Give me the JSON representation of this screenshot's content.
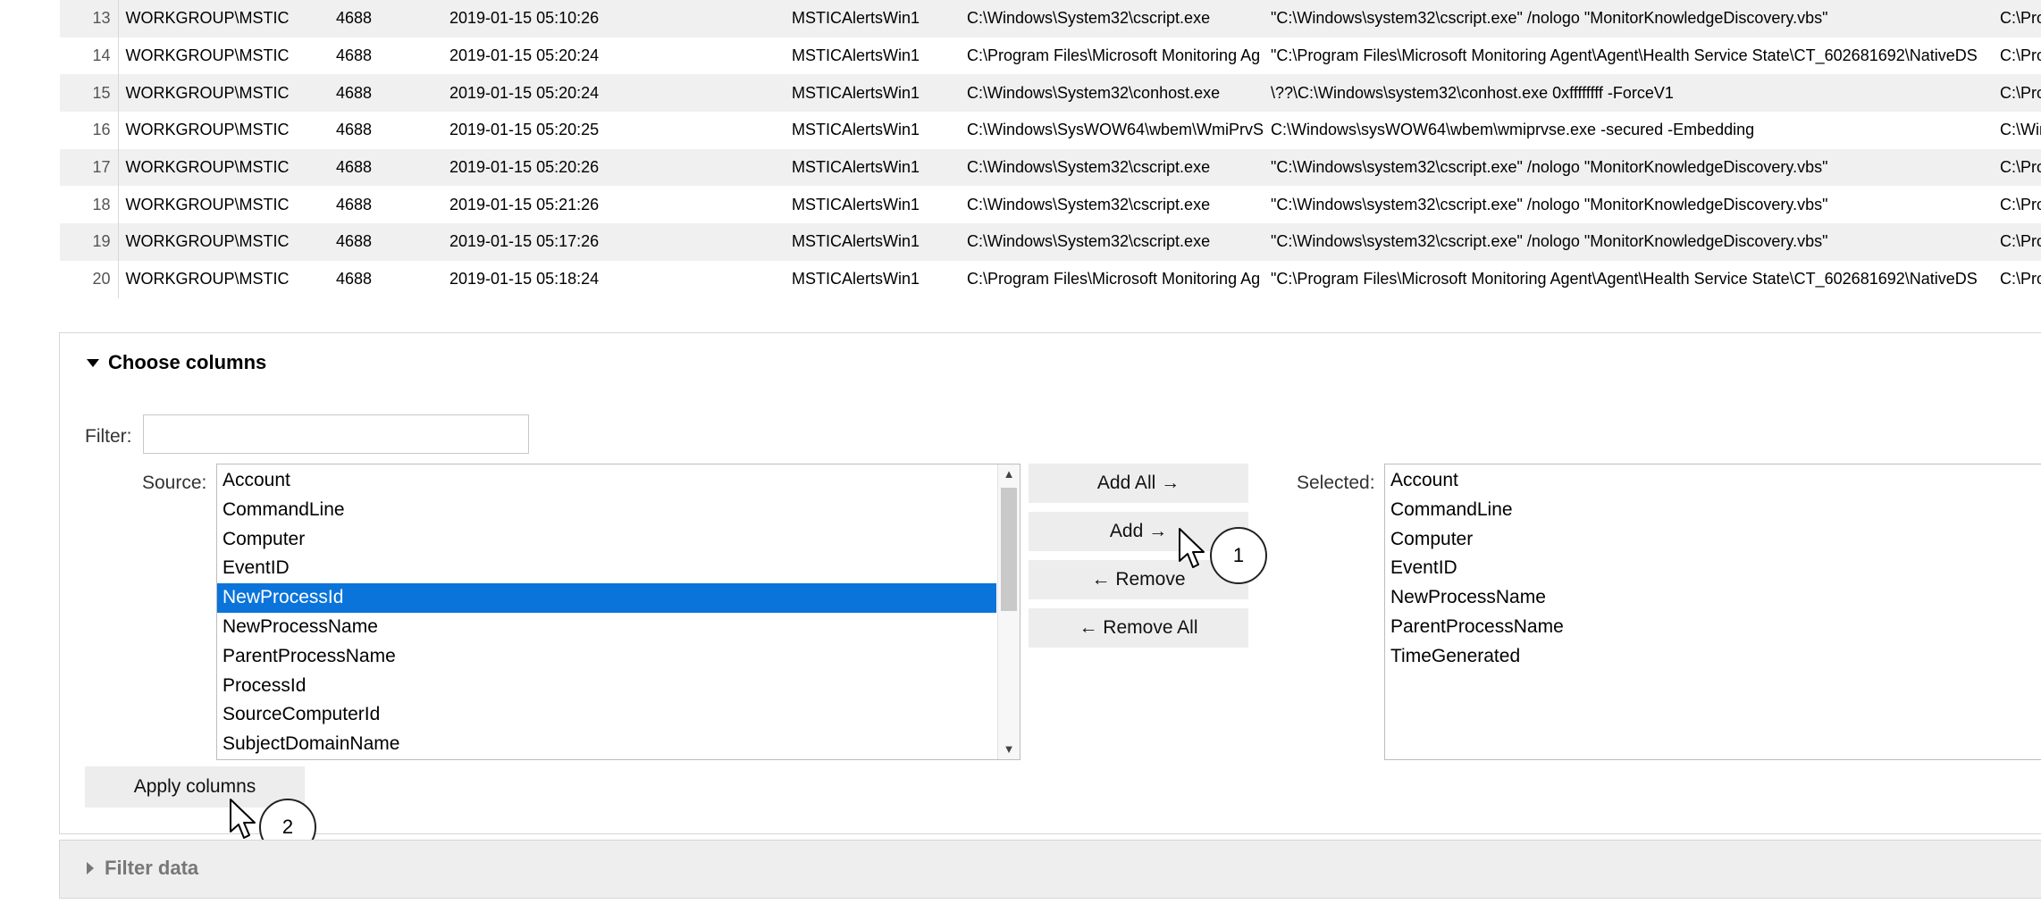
{
  "table": {
    "rows": [
      {
        "idx": "13",
        "account": "WORKGROUP\\MSTIC",
        "event_id": "4688",
        "time": "2019-01-15 05:10:26",
        "computer": "MSTICAlertsWin1",
        "process": "C:\\Windows\\System32\\cscript.exe",
        "cmdline": "\"C:\\Windows\\system32\\cscript.exe\" /nologo \"MonitorKnowledgeDiscovery.vbs\"",
        "parent": "C:\\Progra"
      },
      {
        "idx": "14",
        "account": "WORKGROUP\\MSTIC",
        "event_id": "4688",
        "time": "2019-01-15 05:20:24",
        "computer": "MSTICAlertsWin1",
        "process": "C:\\Program Files\\Microsoft Monitoring Ag",
        "cmdline": "\"C:\\Program Files\\Microsoft Monitoring Agent\\Agent\\Health Service State\\CT_602681692\\NativeDS",
        "parent": "C:\\Progra"
      },
      {
        "idx": "15",
        "account": "WORKGROUP\\MSTIC",
        "event_id": "4688",
        "time": "2019-01-15 05:20:24",
        "computer": "MSTICAlertsWin1",
        "process": "C:\\Windows\\System32\\conhost.exe",
        "cmdline": "\\??\\C:\\Windows\\system32\\conhost.exe 0xffffffff -ForceV1",
        "parent": "C:\\Progra"
      },
      {
        "idx": "16",
        "account": "WORKGROUP\\MSTIC",
        "event_id": "4688",
        "time": "2019-01-15 05:20:25",
        "computer": "MSTICAlertsWin1",
        "process": "C:\\Windows\\SysWOW64\\wbem\\WmiPrvS",
        "cmdline": "C:\\Windows\\sysWOW64\\wbem\\wmiprvse.exe -secured -Embedding",
        "parent": "C:\\Windo"
      },
      {
        "idx": "17",
        "account": "WORKGROUP\\MSTIC",
        "event_id": "4688",
        "time": "2019-01-15 05:20:26",
        "computer": "MSTICAlertsWin1",
        "process": "C:\\Windows\\System32\\cscript.exe",
        "cmdline": "\"C:\\Windows\\system32\\cscript.exe\" /nologo \"MonitorKnowledgeDiscovery.vbs\"",
        "parent": "C:\\Progra"
      },
      {
        "idx": "18",
        "account": "WORKGROUP\\MSTIC",
        "event_id": "4688",
        "time": "2019-01-15 05:21:26",
        "computer": "MSTICAlertsWin1",
        "process": "C:\\Windows\\System32\\cscript.exe",
        "cmdline": "\"C:\\Windows\\system32\\cscript.exe\" /nologo \"MonitorKnowledgeDiscovery.vbs\"",
        "parent": "C:\\Progra"
      },
      {
        "idx": "19",
        "account": "WORKGROUP\\MSTIC",
        "event_id": "4688",
        "time": "2019-01-15 05:17:26",
        "computer": "MSTICAlertsWin1",
        "process": "C:\\Windows\\System32\\cscript.exe",
        "cmdline": "\"C:\\Windows\\system32\\cscript.exe\" /nologo \"MonitorKnowledgeDiscovery.vbs\"",
        "parent": "C:\\Progra"
      },
      {
        "idx": "20",
        "account": "WORKGROUP\\MSTIC",
        "event_id": "4688",
        "time": "2019-01-15 05:18:24",
        "computer": "MSTICAlertsWin1",
        "process": "C:\\Program Files\\Microsoft Monitoring Ag",
        "cmdline": "\"C:\\Program Files\\Microsoft Monitoring Agent\\Agent\\Health Service State\\CT_602681692\\NativeDS",
        "parent": "C:\\Progra"
      }
    ]
  },
  "choose_columns": {
    "title": "Choose columns",
    "filter_label": "Filter:",
    "filter_value": "",
    "source_label": "Source:",
    "selected_label": "Selected:",
    "source_items": [
      "Account",
      "CommandLine",
      "Computer",
      "EventID",
      "NewProcessId",
      "NewProcessName",
      "ParentProcessName",
      "ProcessId",
      "SourceComputerId",
      "SubjectDomainName"
    ],
    "source_selected_item": "NewProcessId",
    "selected_items": [
      "Account",
      "CommandLine",
      "Computer",
      "EventID",
      "NewProcessName",
      "ParentProcessName",
      "TimeGenerated"
    ],
    "buttons": {
      "add_all": "Add All →",
      "add": "Add →",
      "remove": "← Remove",
      "remove_all": "← Remove All",
      "apply": "Apply columns"
    }
  },
  "callouts": {
    "first": "1",
    "second": "2"
  },
  "filter_data": {
    "title": "Filter data"
  },
  "icons": {
    "expanded": "caret-down-icon",
    "collapsed": "caret-right-icon",
    "pointer": "mouse-pointer-icon",
    "scroll_up": "chevron-up-icon",
    "scroll_down": "chevron-down-icon"
  }
}
